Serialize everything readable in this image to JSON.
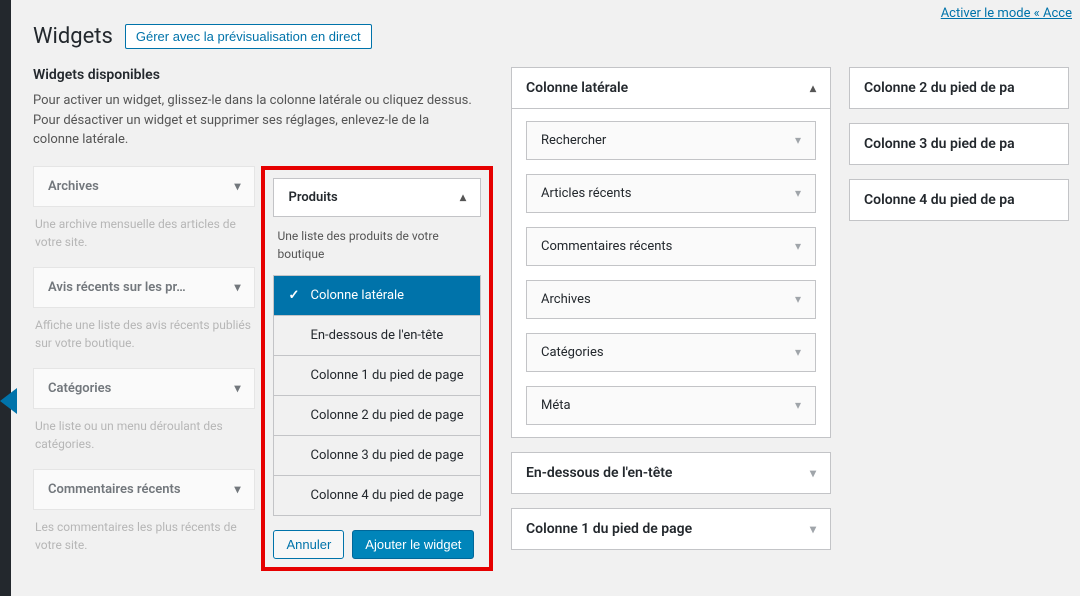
{
  "header": {
    "title": "Widgets",
    "manage_button": "Gérer avec la prévisualisation en direct",
    "access_link": "Activer le mode « Acce"
  },
  "available": {
    "title": "Widgets disponibles",
    "desc": "Pour activer un widget, glissez-le dans la colonne latérale ou cliquez dessus. Pour désactiver un widget et supprimer ses réglages, enlevez-le de la colonne latérale.",
    "left": [
      {
        "title": "Archives",
        "desc": "Une archive mensuelle des articles de votre site."
      },
      {
        "title": "Avis récents sur les pr…",
        "desc": "Affiche une liste des avis récents publiés sur votre boutique."
      },
      {
        "title": "Catégories",
        "desc": "Une liste ou un menu déroulant des catégories."
      },
      {
        "title": "Commentaires récents",
        "desc": "Les commentaires les plus récents de votre site."
      }
    ]
  },
  "produits": {
    "title": "Produits",
    "desc": "Une liste des produits de votre boutique",
    "areas": [
      "Colonne latérale",
      "En-dessous de l'en-tête",
      "Colonne 1 du pied de page",
      "Colonne 2 du pied de page",
      "Colonne 3 du pied de page",
      "Colonne 4 du pied de page"
    ],
    "cancel": "Annuler",
    "add": "Ajouter le widget"
  },
  "sidebar": {
    "title": "Colonne latérale",
    "widgets": [
      "Rechercher",
      "Articles récents",
      "Commentaires récents",
      "Archives",
      "Catégories",
      "Méta"
    ]
  },
  "other_areas": [
    "En-dessous de l'en-tête",
    "Colonne 1 du pied de page"
  ],
  "right_areas": [
    "Colonne 2 du pied de pa",
    "Colonne 3 du pied de pa",
    "Colonne 4 du pied de pa"
  ]
}
